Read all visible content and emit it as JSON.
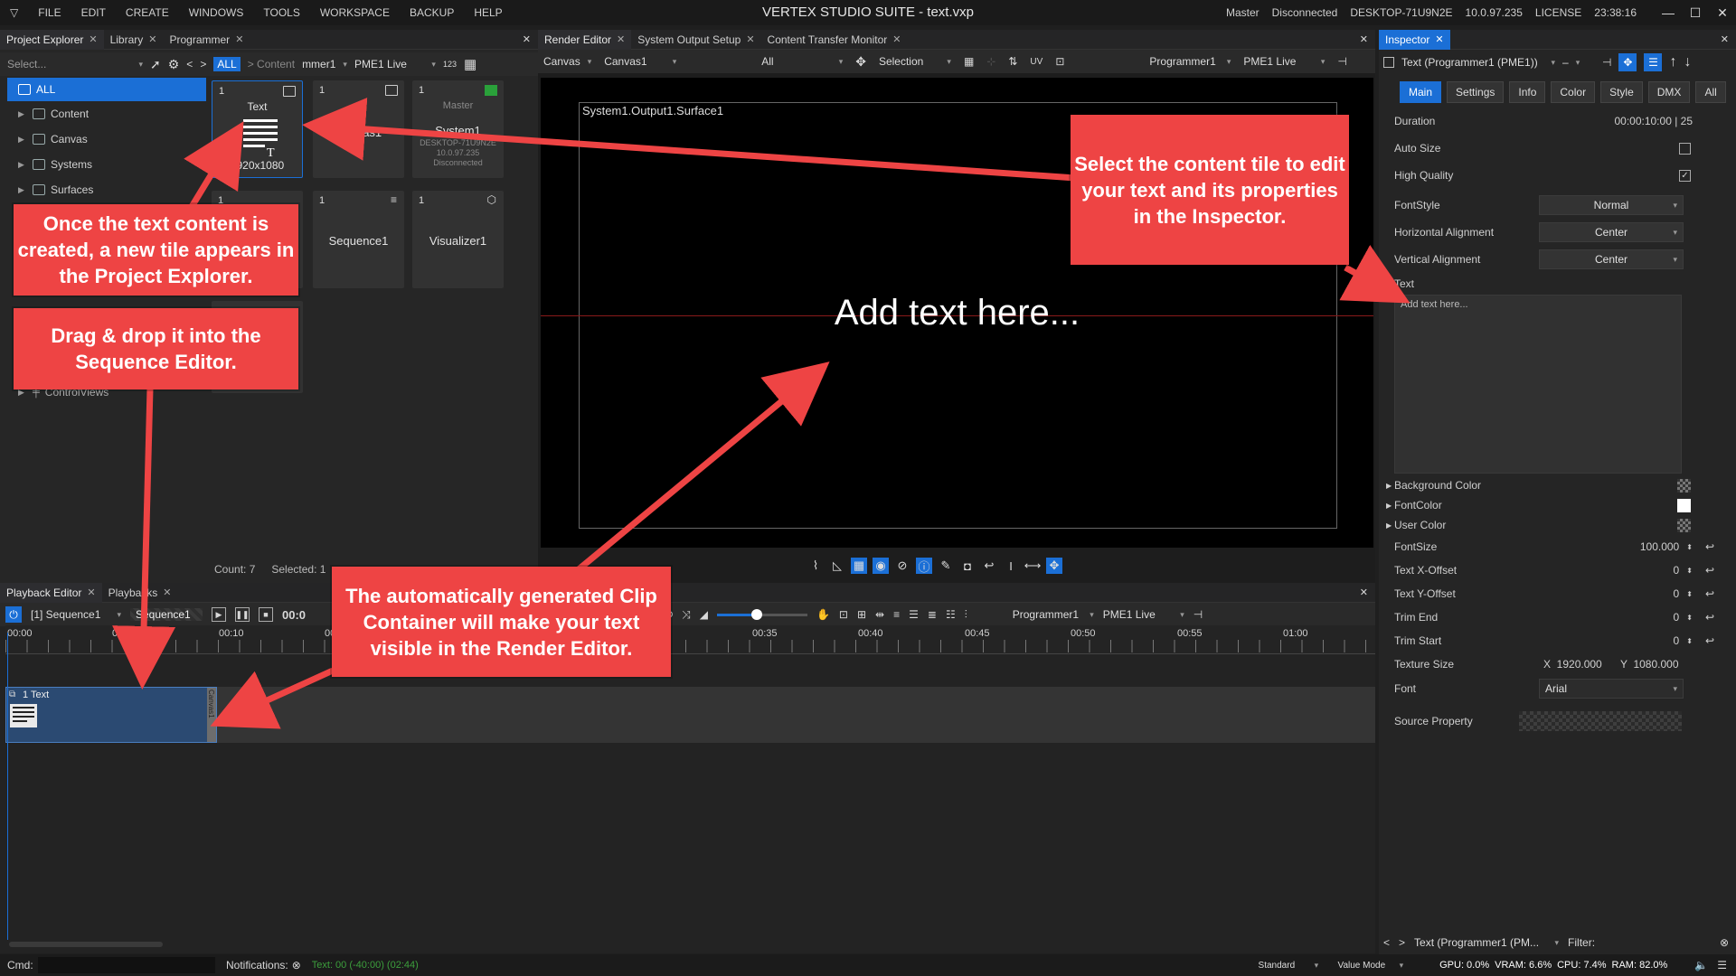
{
  "menu": [
    "FILE",
    "EDIT",
    "CREATE",
    "WINDOWS",
    "TOOLS",
    "WORKSPACE",
    "BACKUP",
    "HELP"
  ],
  "app_title": "VERTEX STUDIO SUITE - text.vxp",
  "sysinfo": {
    "role": "Master",
    "conn": "Disconnected",
    "host": "DESKTOP-71U9N2E",
    "ip": "10.0.97.235",
    "license": "LICENSE",
    "time": "23:38:16"
  },
  "left_tabs": [
    "Project Explorer",
    "Library",
    "Programmer"
  ],
  "explorer": {
    "search_placeholder": "Select...",
    "breadcrumb_all": "ALL",
    "breadcrumb_content": "> Content",
    "programmer_dd": "mmer1",
    "live_dd": "PME1 Live",
    "grid_count": "123",
    "tree": [
      "ALL",
      "Content",
      "Canvas",
      "Systems",
      "Surfaces",
      "ControlViews"
    ],
    "count": "Count: 7",
    "selected": "Selected: 1"
  },
  "tiles": [
    {
      "num": "1",
      "name": "Text",
      "sub": "1920x1080"
    },
    {
      "num": "1",
      "name": "Canvas1",
      "sub": ""
    },
    {
      "num": "1",
      "name": "System1",
      "top": "Master",
      "sub1": "DESKTOP-71U9N2E",
      "sub2": "10.0.97.235",
      "sub3": "Disconnected"
    },
    {
      "num": "1",
      "name": "",
      "sub": ""
    },
    {
      "num": "1",
      "name": "Sequence1",
      "sub": ""
    },
    {
      "num": "1",
      "name": "Visualizer1",
      "sub": ""
    }
  ],
  "center_tabs": [
    "Render Editor",
    "System Output Setup",
    "Content Transfer Monitor"
  ],
  "render": {
    "canvas_dd": "Canvas",
    "canvas1_dd": "Canvas1",
    "all_dd": "All",
    "selection_dd": "Selection",
    "prog_dd": "Programmer1",
    "live_dd": "PME1 Live",
    "surface_label": "System1.Output1.Surface1",
    "text": "Add text here..."
  },
  "playback": {
    "tabs": [
      "Playback Editor",
      "Playbacks"
    ],
    "seq_dd": "[1] Sequence1",
    "seq_name": "Sequence1",
    "time": "00:0",
    "prog_dd": "Programmer1",
    "live_dd": "PME1 Live",
    "ticks": [
      "00:00",
      "00:0",
      "00:10",
      "00:",
      "00:35",
      "00:40",
      "00:45",
      "00:50",
      "00:55",
      "01:00"
    ],
    "clip_label": "1 Text",
    "clip_side": "Canvas1"
  },
  "inspector": {
    "tab": "Inspector",
    "object_dd": "Text (Programmer1 (PME1))",
    "minus": "–",
    "tabs": [
      "Main",
      "Settings",
      "Info",
      "Color",
      "Style",
      "DMX",
      "All"
    ],
    "duration_label": "Duration",
    "duration_value": "00:00:10:00 | 25",
    "autosize": "Auto Size",
    "highq": "High Quality",
    "fontstyle": "FontStyle",
    "fontstyle_v": "Normal",
    "halign": "Horizontal Alignment",
    "halign_v": "Center",
    "valign": "Vertical Alignment",
    "valign_v": "Center",
    "text_label": "Text",
    "text_value": "Add text here...",
    "bg": "Background Color",
    "fc": "FontColor",
    "uc": "User Color",
    "fontsize": "FontSize",
    "fontsize_v": "100.000",
    "xoff": "Text X-Offset",
    "xoff_v": "0",
    "yoff": "Text Y-Offset",
    "yoff_v": "0",
    "trimend": "Trim End",
    "trimend_v": "0",
    "trimstart": "Trim Start",
    "trimstart_v": "0",
    "texsize": "Texture Size",
    "tex_x": "X  1920.000",
    "tex_y": "Y  1080.000",
    "font": "Font",
    "font_v": "Arial",
    "source": "Source Property",
    "footer_dd": "Text (Programmer1 (PM...",
    "filter": "Filter:"
  },
  "status": {
    "cmd": "Cmd:",
    "notifications": "Notifications:",
    "log": "Text: 00 (-40:00) (02:44)",
    "mode1": "Standard",
    "mode2": "Value Mode",
    "gpu": "GPU: 0.0%",
    "vram": "VRAM: 6.6%",
    "cpu": "CPU: 7.4%",
    "ram": "RAM: 82.0%"
  },
  "callouts": {
    "c1": "Once the text content is created, a new tile appears in the Project Explorer.",
    "c2": "Drag & drop it into the Sequence Editor.",
    "c3": "Select the content tile to edit your text and its properties in the Inspector.",
    "c4": "The automatically generated Clip Container will make your text visible in the Render Editor."
  },
  "colors": {
    "accent": "#1b6fd6",
    "callout": "#ee4444",
    "clip": "#2b4a72"
  }
}
